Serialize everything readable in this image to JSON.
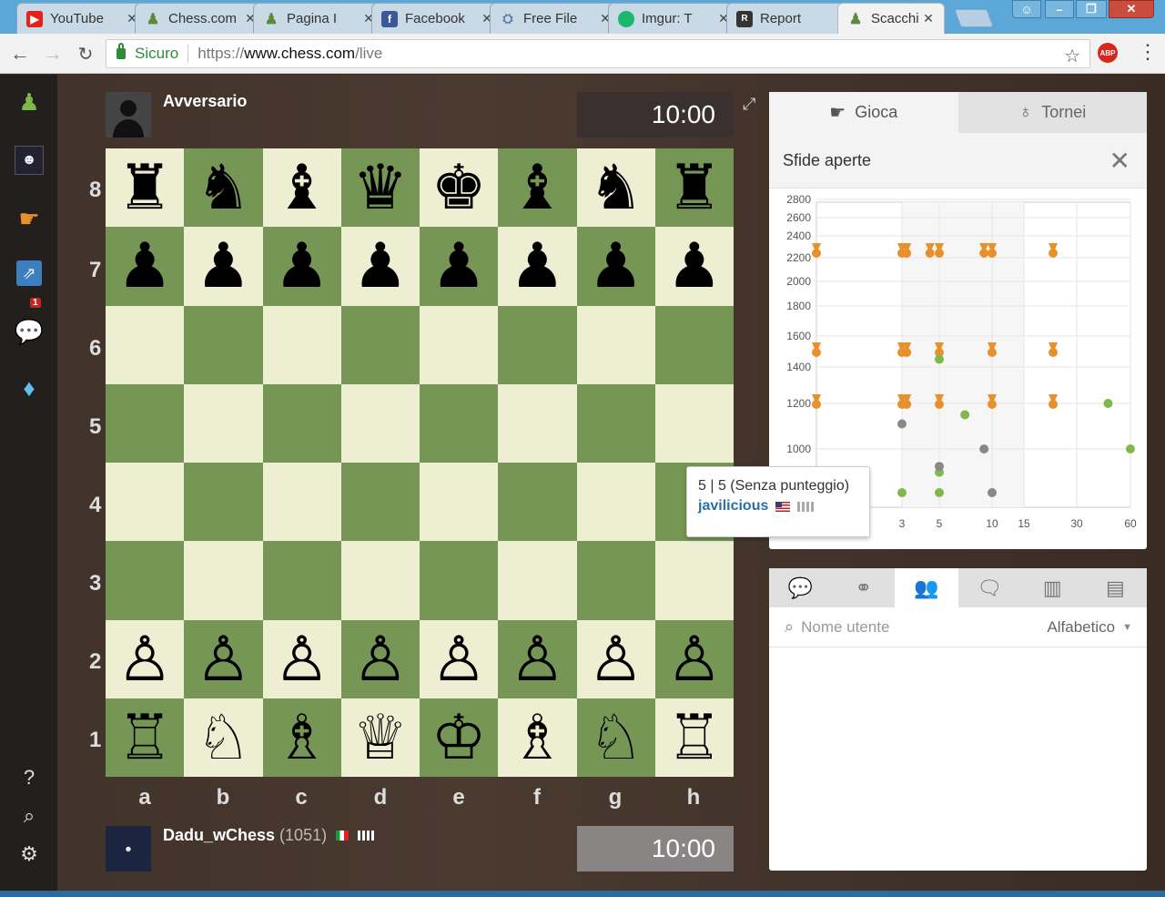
{
  "browser": {
    "tabs": [
      {
        "label": "YouTube",
        "icon": "youtube-icon"
      },
      {
        "label": "Chess.com",
        "icon": "pawn-icon"
      },
      {
        "label": "Pagina I",
        "icon": "pawn-icon"
      },
      {
        "label": "Facebook",
        "icon": "facebook-icon"
      },
      {
        "label": "Free File",
        "icon": "file-icon"
      },
      {
        "label": "Imgur: T",
        "icon": "imgur-icon"
      },
      {
        "label": "Report",
        "icon": "report-icon"
      },
      {
        "label": "Scacchi",
        "icon": "pawn-icon"
      }
    ],
    "secure_label": "Sicuro",
    "url_scheme": "https://",
    "url_host": "www.chess.com",
    "url_path": "/live",
    "abp": "ABP"
  },
  "opponent": {
    "name": "Avversario",
    "clock": "10:00"
  },
  "player": {
    "name": "Dadu_wChess",
    "rating": "(1051)",
    "clock": "10:00"
  },
  "board": {
    "ranks": [
      "8",
      "7",
      "6",
      "5",
      "4",
      "3",
      "2",
      "1"
    ],
    "files": [
      "a",
      "b",
      "c",
      "d",
      "e",
      "f",
      "g",
      "h"
    ],
    "pieces": [
      [
        "♜",
        "♞",
        "♝",
        "♛",
        "♚",
        "♝",
        "♞",
        "♜"
      ],
      [
        "♟",
        "♟",
        "♟",
        "♟",
        "♟",
        "♟",
        "♟",
        "♟"
      ],
      [
        "",
        "",
        "",
        "",
        "",
        "",
        "",
        ""
      ],
      [
        "",
        "",
        "",
        "",
        "",
        "",
        "",
        ""
      ],
      [
        "",
        "",
        "",
        "",
        "",
        "",
        "",
        ""
      ],
      [
        "",
        "",
        "",
        "",
        "",
        "",
        "",
        ""
      ],
      [
        "♙",
        "♙",
        "♙",
        "♙",
        "♙",
        "♙",
        "♙",
        "♙"
      ],
      [
        "♖",
        "♘",
        "♗",
        "♕",
        "♔",
        "♗",
        "♘",
        "♖"
      ]
    ]
  },
  "panel": {
    "tab_play": "Gioca",
    "tab_tournaments": "Tornei",
    "section_title": "Sfide aperte"
  },
  "tooltip": {
    "title": "5 | 5 (Senza punteggio)",
    "user": "javilicious"
  },
  "chart_data": {
    "type": "scatter",
    "x_ticks": [
      "3",
      "5",
      "10",
      "15",
      "30",
      "60"
    ],
    "y_ticks": [
      "2800",
      "2600",
      "2400",
      "2200",
      "2000",
      "1800",
      "1600",
      "1400",
      "1200",
      "1000"
    ],
    "series": [
      {
        "marker": "orange-medal",
        "color": "#e8912c",
        "points": [
          [
            1,
            2250
          ],
          [
            3,
            2250
          ],
          [
            3.2,
            2250
          ],
          [
            4.4,
            2250
          ],
          [
            5,
            2250
          ],
          [
            9,
            2250
          ],
          [
            10,
            2250
          ],
          [
            22,
            2250
          ],
          [
            1,
            1500
          ],
          [
            3,
            1500
          ],
          [
            3.2,
            1500
          ],
          [
            5,
            1500
          ],
          [
            10,
            1500
          ],
          [
            22,
            1500
          ],
          [
            1,
            1200
          ],
          [
            3,
            1200
          ],
          [
            3.2,
            1200
          ],
          [
            5,
            1200
          ],
          [
            10,
            1200
          ],
          [
            22,
            1200
          ]
        ]
      },
      {
        "marker": "green-dot",
        "color": "#80b84a",
        "points": [
          [
            7,
            1150
          ],
          [
            45,
            1200
          ],
          [
            60,
            1000
          ],
          [
            5,
            920
          ],
          [
            3,
            850
          ],
          [
            5,
            850
          ],
          [
            5,
            1450
          ]
        ]
      },
      {
        "marker": "gray-dot",
        "color": "#888888",
        "points": [
          [
            3,
            1110
          ],
          [
            5,
            940
          ],
          [
            9,
            1000
          ],
          [
            10,
            850
          ]
        ]
      }
    ]
  },
  "panel2": {
    "search_placeholder": "Nome utente",
    "sort_label": "Alfabetico"
  },
  "colors": {
    "light_square": "#eeeed2",
    "dark_square": "#769656",
    "accent": "#e8912c"
  }
}
